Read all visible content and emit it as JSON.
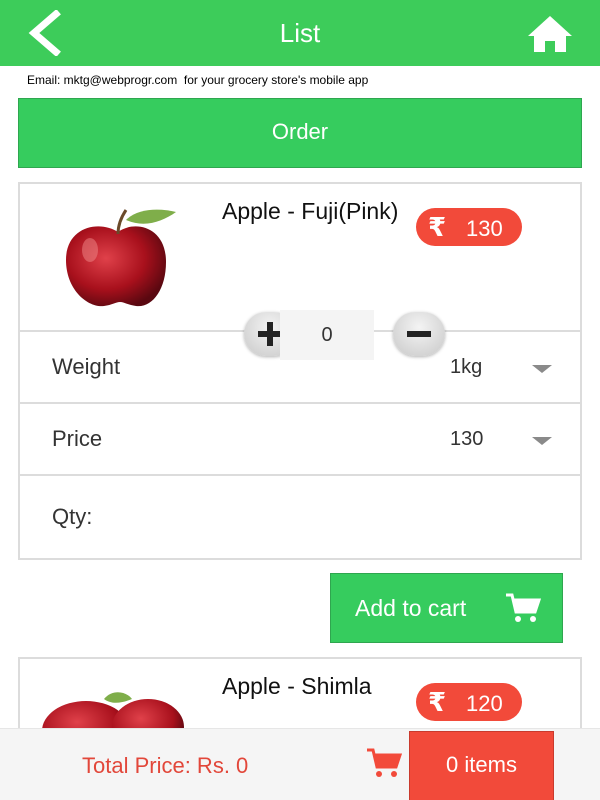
{
  "header": {
    "title": "List",
    "back_icon": "back-arrow-icon",
    "home_icon": "home-icon",
    "color": "#3dcc5a"
  },
  "email_notice": "Email: mktg@webprogr.com  for your grocery store's mobile app",
  "order_button": "Order",
  "products": [
    {
      "name": "Apple - Fuji(Pink)",
      "currency_symbol": "₹",
      "price": "130",
      "image_icon": "apple-image",
      "weight_label": "Weight",
      "weight_value": "1kg",
      "price_label": "Price",
      "price_value": "130",
      "qty_label": "Qty:",
      "qty_value": "0"
    },
    {
      "name": "Apple - Shimla",
      "currency_symbol": "₹",
      "price": "120",
      "image_icon": "apples-image"
    }
  ],
  "add_to_cart": "Add to cart",
  "footer": {
    "total_price": "Total Price: Rs. 0",
    "items": "0 items"
  },
  "colors": {
    "accent_green": "#36cc5e",
    "accent_red": "#f24a3a"
  }
}
